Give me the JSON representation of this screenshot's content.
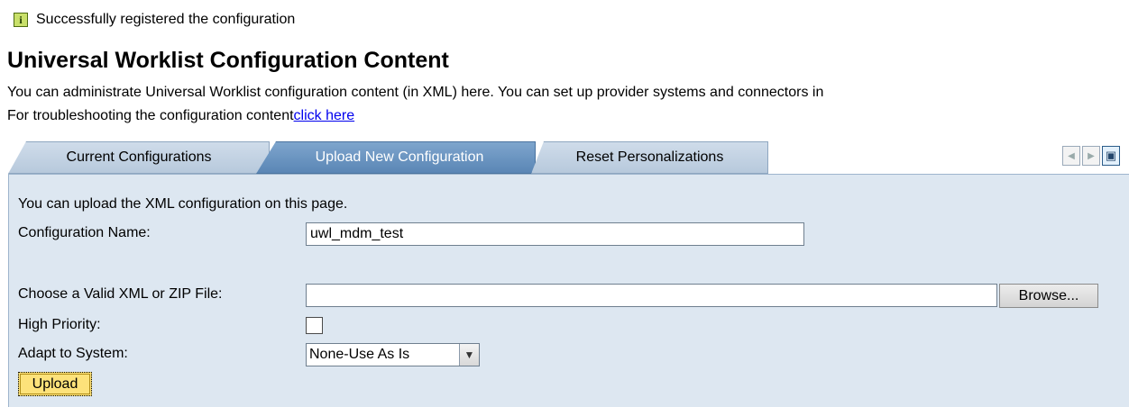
{
  "message": {
    "icon": "info-icon",
    "icon_glyph": "i",
    "text": "Successfully registered the configuration"
  },
  "page": {
    "title": "Universal Worklist Configuration Content",
    "description": "You can administrate Universal Worklist configuration content (in XML) here. You can set up provider systems and connectors in",
    "troubleshoot_text": "For troubleshooting the configuration content",
    "troubleshoot_link": "click here"
  },
  "tabs": [
    {
      "label": "Current Configurations",
      "active": false
    },
    {
      "label": "Upload New Configuration",
      "active": true
    },
    {
      "label": "Reset Personalizations",
      "active": false
    }
  ],
  "tab_nav": {
    "prev_icon": "scroll-left-icon",
    "next_icon": "scroll-right-icon",
    "menu_icon": "tab-list-icon"
  },
  "form": {
    "intro": "You can upload the XML configuration on this page.",
    "config_name_label": "Configuration Name:",
    "config_name_value": "uwl_mdm_test",
    "file_label": "Choose a Valid XML or ZIP File:",
    "file_value": "",
    "browse_label": "Browse...",
    "priority_label": "High Priority:",
    "priority_checked": false,
    "adapt_label": "Adapt to System:",
    "adapt_value": "None-Use As Is",
    "upload_label": "Upload"
  },
  "colors": {
    "active_tab": "#5a86b5",
    "panel_bg": "#dde7f1",
    "upload_button": "#fde27a"
  }
}
